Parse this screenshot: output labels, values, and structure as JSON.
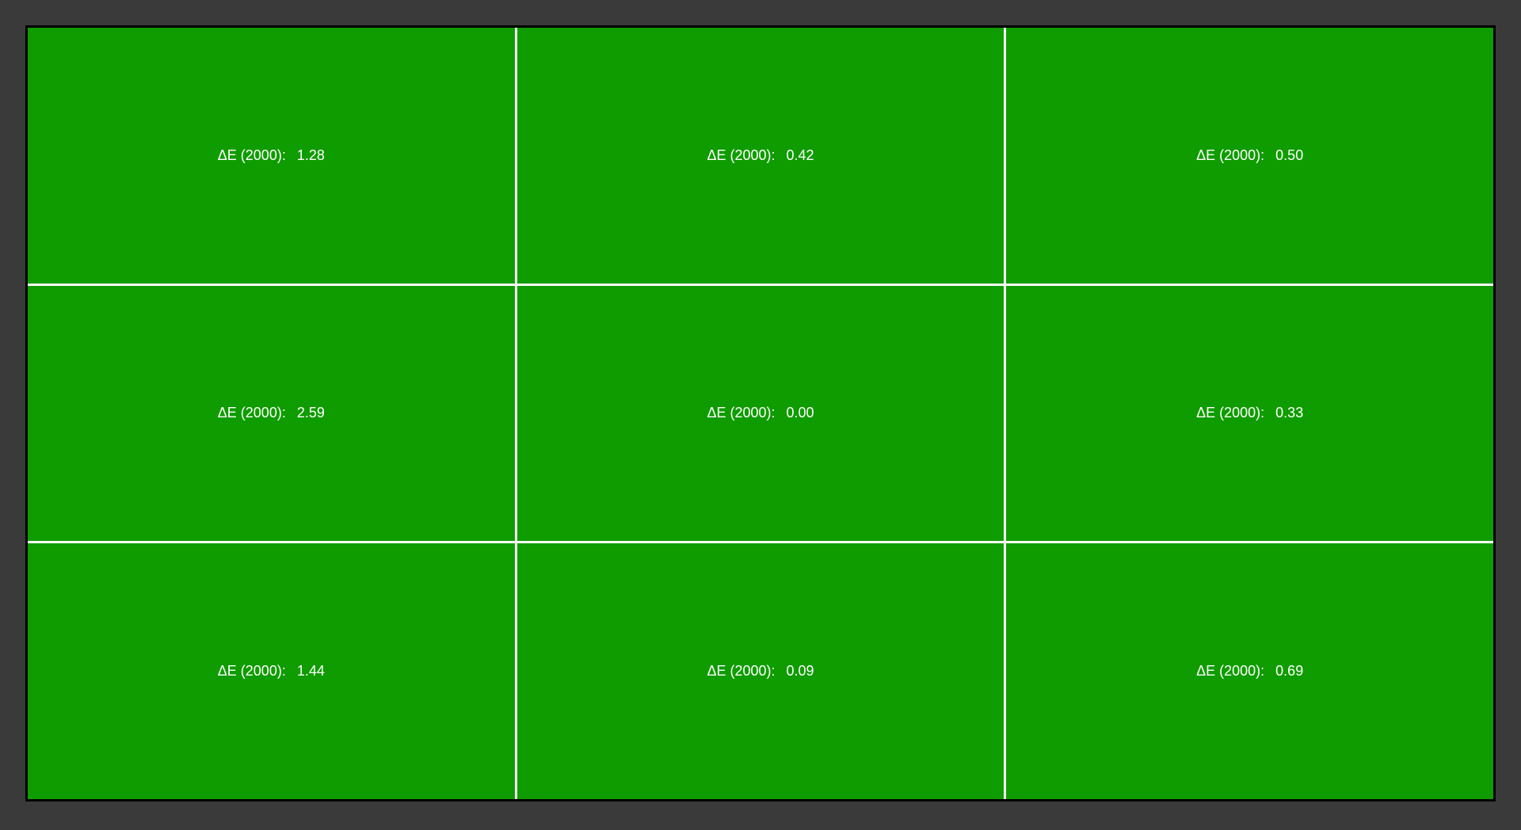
{
  "delta_label": "ΔE (2000):",
  "cells": [
    {
      "value": "1.28"
    },
    {
      "value": "0.42"
    },
    {
      "value": "0.50"
    },
    {
      "value": "2.59"
    },
    {
      "value": "0.00"
    },
    {
      "value": "0.33"
    },
    {
      "value": "1.44"
    },
    {
      "value": "0.09"
    },
    {
      "value": "0.69"
    }
  ],
  "background_color": "#3a3a3a",
  "cell_color": "#0f9c00",
  "text_color": "#ffffff"
}
